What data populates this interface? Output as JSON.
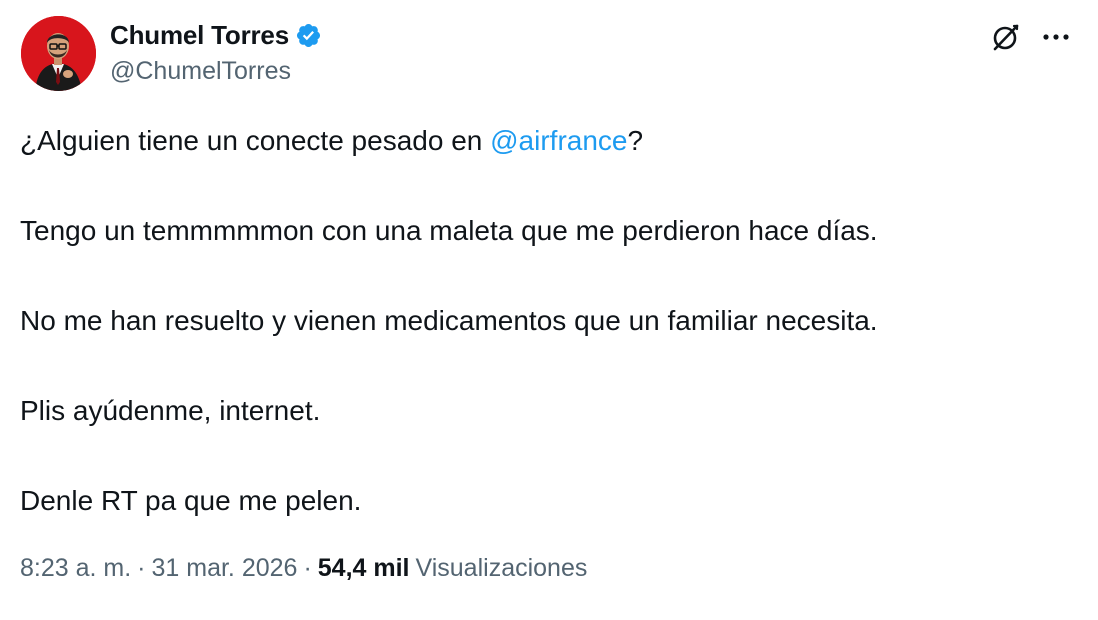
{
  "author": {
    "display_name": "Chumel Torres",
    "handle": "@ChumelTorres",
    "verified": true,
    "verified_icon": "verified-badge-icon",
    "avatar_bg": "#d8151c"
  },
  "header_actions": {
    "grok_icon": "grok-icon",
    "more_icon": "more-dots-icon"
  },
  "tweet": {
    "line1_before": "¿Alguien tiene un conecte pesado en ",
    "line1_mention": "@airfrance",
    "line1_after": "?",
    "line2": "Tengo un temmmmmon con una maleta que me perdieron hace días.",
    "line3": "No me han resuelto y vienen medicamentos que un familiar necesita.",
    "line4": "Plis ayúdenme, internet.",
    "line5": "Denle RT pa que me pelen."
  },
  "meta": {
    "time": "8:23 a. m.",
    "separator": "·",
    "date": "31 mar. 2026",
    "views_count": "54,4 mil",
    "views_label": "Visualizaciones"
  },
  "colors": {
    "link": "#1d9bf0",
    "secondary_text": "#536471",
    "primary_text": "#0f1419",
    "verified": "#1d9bf0"
  }
}
